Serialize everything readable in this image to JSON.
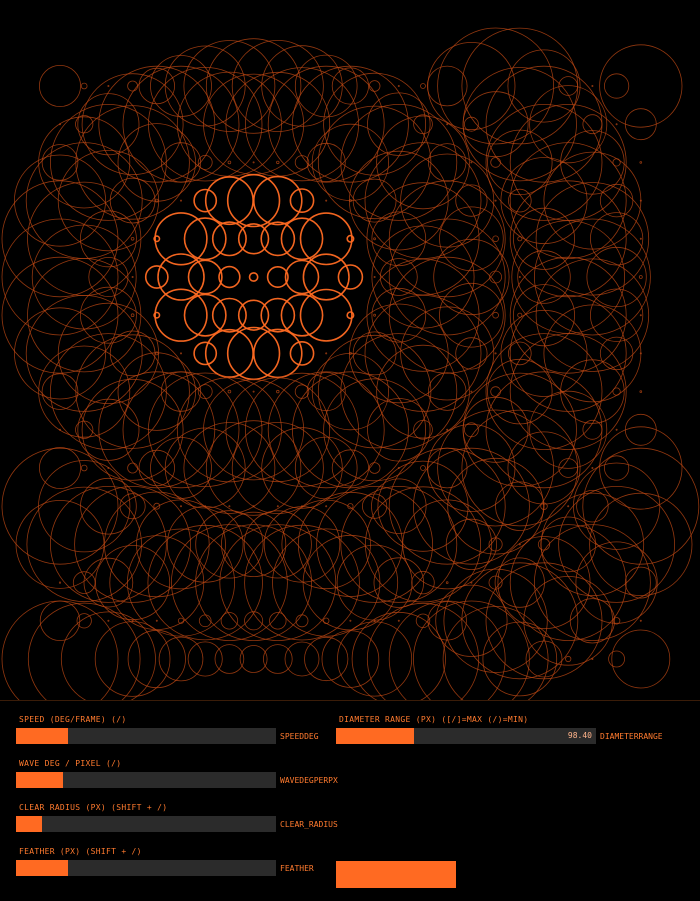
{
  "colors": {
    "accent": "#ff6a22",
    "track": "#2b2b2b",
    "background": "#000000"
  },
  "controls": {
    "speed": {
      "label": "SPEED (DEG/FRAME) (/)",
      "name": "SPEEDDEG",
      "fraction": 0.2,
      "value": ""
    },
    "wave": {
      "label": "WAVE DEG / PIXEL (/)",
      "name": "WAVEDEGPERPX",
      "fraction": 0.18,
      "value": ""
    },
    "clear": {
      "label": "CLEAR RADIUS (PX) (SHIFT + /)",
      "name": "CLEAR_RADIUS",
      "fraction": 0.1,
      "value": ""
    },
    "feather": {
      "label": "FEATHER (PX) (SHIFT + /)",
      "name": "FEATHER",
      "fraction": 0.2,
      "value": ""
    },
    "diameter": {
      "label": "DIAMETER RANGE (PX) ([/]=MAX (/)=MIN)",
      "name": "DIAMETERRANGE",
      "fraction": 0.3,
      "value": "98.40"
    }
  },
  "visualization": {
    "grid_cols": 25,
    "grid_rows": 16,
    "stroke_color": "#c24a14",
    "highlight_color": "#ff6a22"
  }
}
